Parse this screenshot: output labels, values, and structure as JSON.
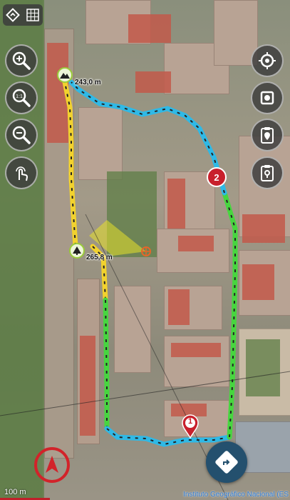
{
  "map": {
    "scale_label": "100 m",
    "attribution": "Instituto Geográfico Nacional (ES",
    "waypoints": {
      "start_elevation": "243,0 m",
      "summit_elevation": "265,8 m",
      "marker_1": "1",
      "marker_2": "2"
    },
    "colors": {
      "track_yellow": "#f2d22e",
      "track_green": "#47d63f",
      "track_blue": "#2fb9e6",
      "accent_red": "#d2232a",
      "nav_button": "#24506e"
    }
  },
  "controls": {
    "left": [
      "zoom-in-icon",
      "zoom-1to1-icon",
      "zoom-out-icon",
      "touch-mode-icon"
    ],
    "right": [
      "locate-target-icon",
      "record-stop-icon",
      "waypoint-list-icon",
      "waypoint-location-icon"
    ]
  }
}
